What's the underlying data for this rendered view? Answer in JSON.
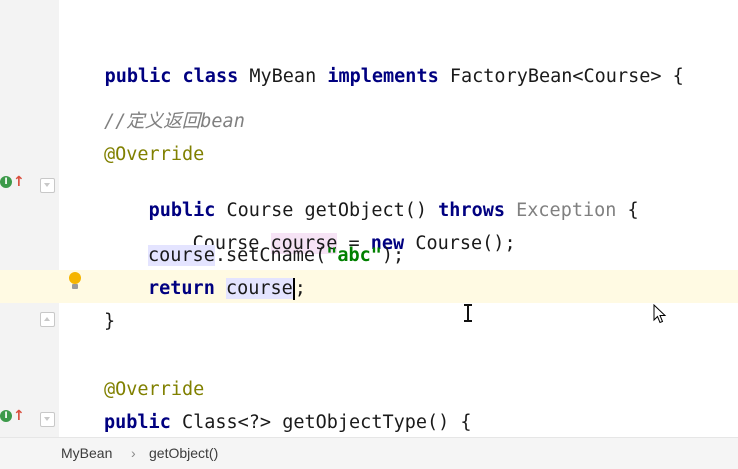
{
  "editor": {
    "lines": {
      "class_decl": {
        "kw1": "public",
        "kw2": "class",
        "name": "MyBean",
        "kw3": "implements",
        "iface": "FactoryBean<Course>",
        "brace": "{"
      },
      "comment": "//定义返回bean",
      "override1": "@Override",
      "get_object": {
        "kw1": "public",
        "type": "Course",
        "name": "getObject()",
        "kw2": "throws",
        "exc": "Exception",
        "brace": "{"
      },
      "decl": {
        "type": "Course",
        "var": "course",
        "eq": "=",
        "kw": "new",
        "ctor": "Course();"
      },
      "call": {
        "var": "course",
        "method": ".setCname(",
        "str": "\"abc\"",
        "end": ");"
      },
      "ret": {
        "kw": "return",
        "var": "course",
        "semi": ";"
      },
      "close": "}",
      "override2": "@Override",
      "get_type": {
        "kw1": "public",
        "rest": "Class<?> getObjectType() {"
      }
    }
  },
  "gutter": {
    "impl_marker_letter": "I",
    "impl_marker_arrow": "↑"
  },
  "breadcrumb": {
    "class": "MyBean",
    "separator": "›",
    "method": "getObject()"
  },
  "colors": {
    "keyword": "#000080",
    "annotation": "#808000",
    "comment": "#808080",
    "string": "#008000",
    "current_line": "#fffae3",
    "usage_highlight": "#e4e4ff",
    "write_highlight": "#f6e3f5"
  }
}
